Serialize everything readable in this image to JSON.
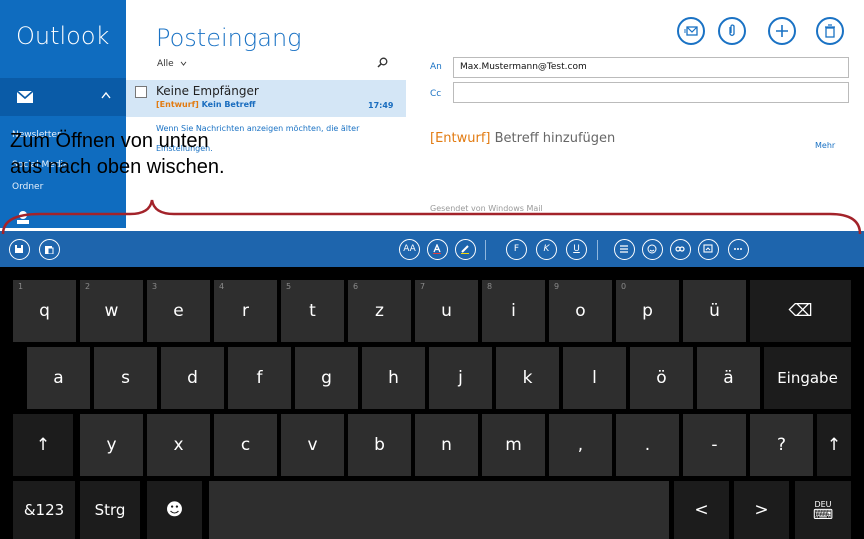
{
  "app": {
    "title": "Outlook"
  },
  "sidebar": {
    "folders": [
      "Newsletter",
      "Social Media",
      "Ordner"
    ]
  },
  "inbox": {
    "title": "Posteingang",
    "filter": "Alle",
    "message": {
      "sender": "Keine Empfänger",
      "draft_tag": "[Entwurf]",
      "subject": "Kein Betreff",
      "time": "17:49"
    },
    "note_parts": [
      "Wenn Sie Nachrichten anzeigen möchten, die älter",
      "Einstellungen."
    ]
  },
  "compose": {
    "to_label": "An",
    "to_value": "Max.Mustermann@Test.com",
    "cc_label": "Cc",
    "more": "Mehr",
    "subject_tag": "[Entwurf]",
    "subject_placeholder": "Betreff hinzufügen",
    "signature": "Gesendet von Windows Mail"
  },
  "overlay": {
    "line1": "Zum Öffnen von unten",
    "line2": "aus nach oben wischen."
  },
  "keyboard": {
    "row1": [
      {
        "label": "q",
        "num": "1"
      },
      {
        "label": "w",
        "num": "2"
      },
      {
        "label": "e",
        "num": "3"
      },
      {
        "label": "r",
        "num": "4"
      },
      {
        "label": "t",
        "num": "5"
      },
      {
        "label": "z",
        "num": "6"
      },
      {
        "label": "u",
        "num": "7"
      },
      {
        "label": "i",
        "num": "8"
      },
      {
        "label": "o",
        "num": "9"
      },
      {
        "label": "p",
        "num": "0"
      },
      {
        "label": "ü",
        "num": ""
      }
    ],
    "row2": [
      "a",
      "s",
      "d",
      "f",
      "g",
      "h",
      "j",
      "k",
      "l",
      "ö",
      "ä"
    ],
    "enter": "Eingabe",
    "row3": [
      "y",
      "x",
      "c",
      "v",
      "b",
      "n",
      "m",
      ",",
      ".",
      "-",
      "?"
    ],
    "shift_glyph": "↑",
    "backspace_glyph": "⌫",
    "sym": "&123",
    "ctrl": "Strg",
    "emoji_glyph": "☻",
    "left_glyph": "<",
    "right_glyph": ">",
    "lang": "DEU",
    "kb_glyph": "⌨",
    "format_letters": {
      "font_size": "AA",
      "bold": "F",
      "italic": "K",
      "underline": "U"
    }
  },
  "colors": {
    "rail": "#0f6cbf",
    "accent": "#1a72c4",
    "draft": "#e27b12",
    "toolbar": "#1e65ad",
    "brace": "#a3232a"
  }
}
